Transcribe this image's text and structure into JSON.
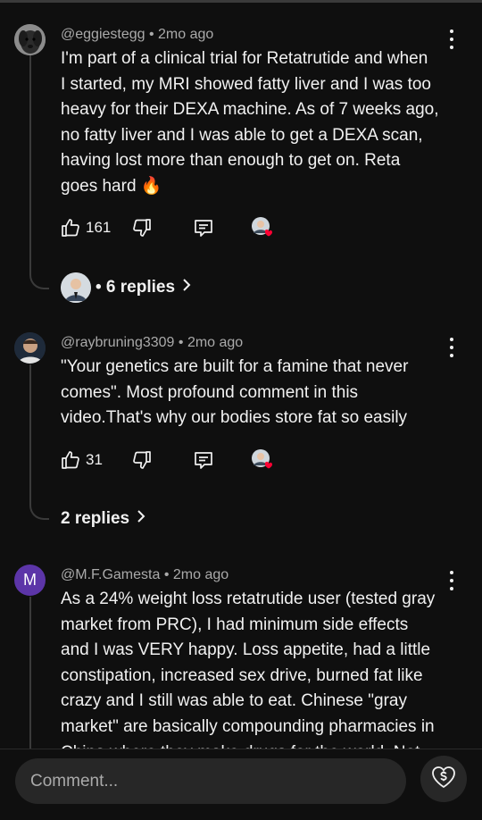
{
  "comments": [
    {
      "author": "@eggiestegg",
      "time": "2mo ago",
      "separator": " • ",
      "text_lines": [
        "I'm part of a clinical trial for Retatrutide and when",
        "I started, my MRI showed fatty liver and I was too",
        "heavy for their DEXA machine. As of 7 weeks ago,",
        "no fatty liver and I was able to get a DEXA scan,",
        "having lost more than enough to get on. Reta",
        "goes hard 🔥"
      ],
      "likes": "161",
      "replies_label": "• 6 replies"
    },
    {
      "author": "@raybruning3309",
      "time": "2mo ago",
      "separator": " • ",
      "text_lines": [
        "\"Your genetics are built for a famine that never",
        "comes\". Most profound comment in this",
        "video.That's why our bodies store fat so easily"
      ],
      "likes": "31",
      "replies_label": "2 replies"
    },
    {
      "author": "@M.F.Gamesta",
      "time": "2mo ago",
      "separator": " • ",
      "avatar_letter": "M",
      "text_lines": [
        "As a 24% weight loss retatrutide user (tested gray",
        "market from PRC), I had minimum side effects",
        "and I was VERY happy.   Loss appetite, had a little",
        "constipation, increased sex drive, burned fat like",
        "crazy and I still was able to eat.  Chinese \"gray",
        "market\" are basically compounding pharmacies in",
        "China where they make drugs for the world. Not"
      ]
    }
  ],
  "composer": {
    "placeholder": "Comment..."
  },
  "icons": [
    "like-icon",
    "dislike-icon",
    "reply-icon",
    "creator-heart-icon",
    "more-icon",
    "chevron-right-icon",
    "super-thanks-icon"
  ],
  "colors": {
    "background": "#0f0f0f",
    "text": "#f1f1f1",
    "secondary": "#aaaaaa",
    "heart": "#ff0033",
    "avatar_m": "#5c35a8"
  }
}
